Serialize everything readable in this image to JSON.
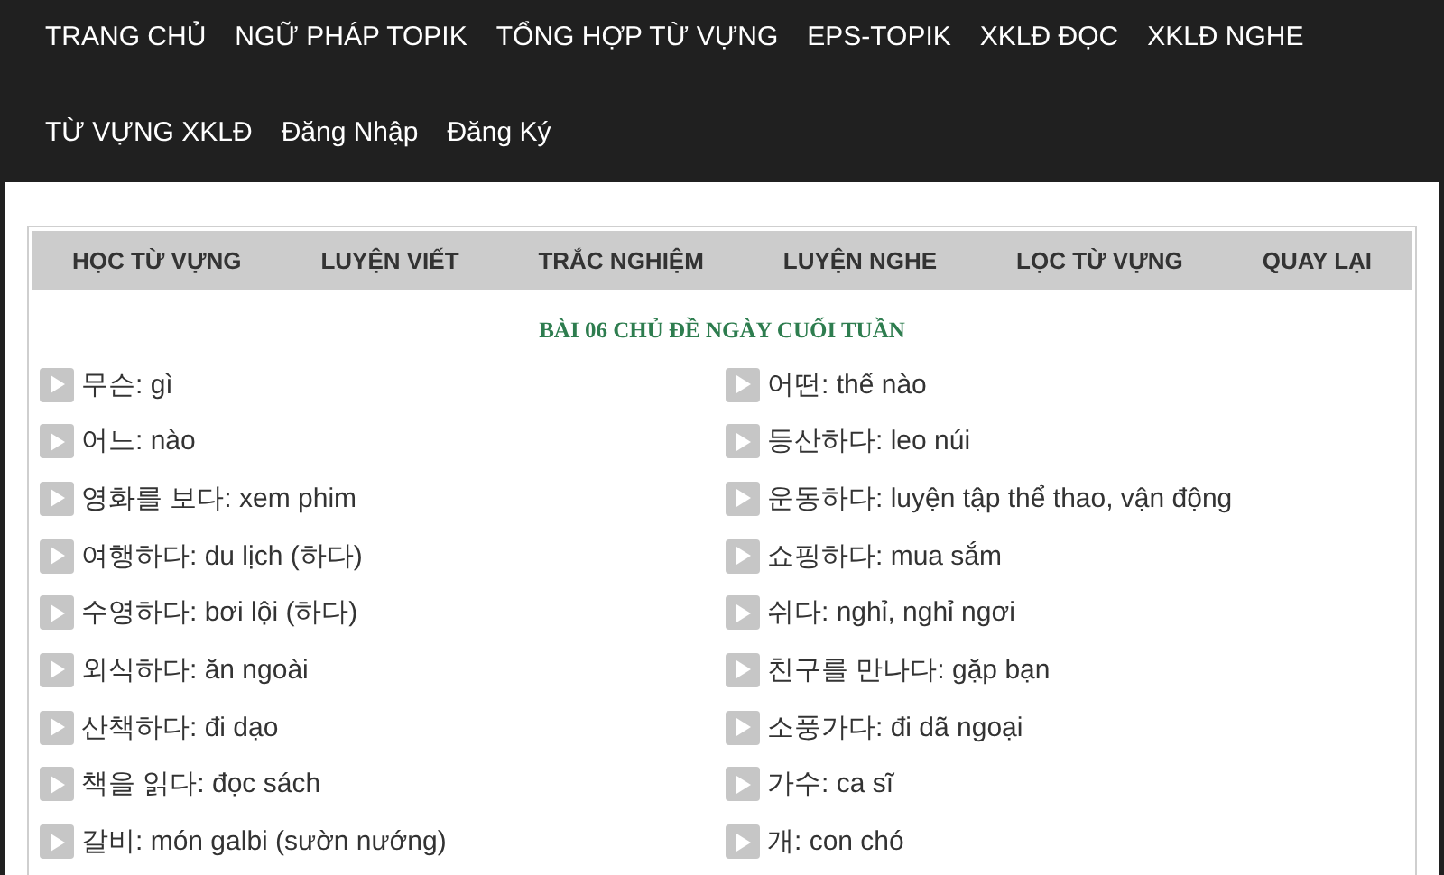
{
  "nav": [
    "TRANG CHỦ",
    "NGỮ PHÁP TOPIK",
    "TỔNG HỢP TỪ VỰNG",
    "EPS-TOPIK",
    "XKLĐ ĐỌC",
    "XKLĐ NGHE",
    "TỪ VỰNG XKLĐ",
    "Đăng Nhập",
    "Đăng Ký"
  ],
  "menu": [
    "HỌC TỪ VỰNG",
    "LUYỆN VIẾT",
    "TRẮC NGHIỆM",
    "LUYỆN NGHE",
    "LỌC TỪ VỰNG",
    "QUAY LẠI"
  ],
  "lesson_title": "BÀI 06 CHỦ ĐỀ NGÀY CUỐI TUẦN",
  "vocab_columns": [
    [
      "무슨: gì",
      "어느: nào",
      "영화를 보다: xem phim",
      "여행하다: du lịch (하다)",
      "수영하다: bơi lội (하다)",
      "외식하다: ăn ngoài",
      "산책하다: đi dạo",
      "책을 읽다: đọc sách",
      "갈비: món galbi (sườn nướng)"
    ],
    [
      "어떤: thế nào",
      "등산하다: leo núi",
      "운동하다: luyện tập thể thao, vận động",
      "쇼핑하다: mua sắm",
      "쉬다: nghỉ, nghỉ ngơi",
      "친구를 만나다: gặp bạn",
      "소풍가다: đi dã ngoại",
      "가수: ca sĩ",
      "개: con chó"
    ]
  ]
}
